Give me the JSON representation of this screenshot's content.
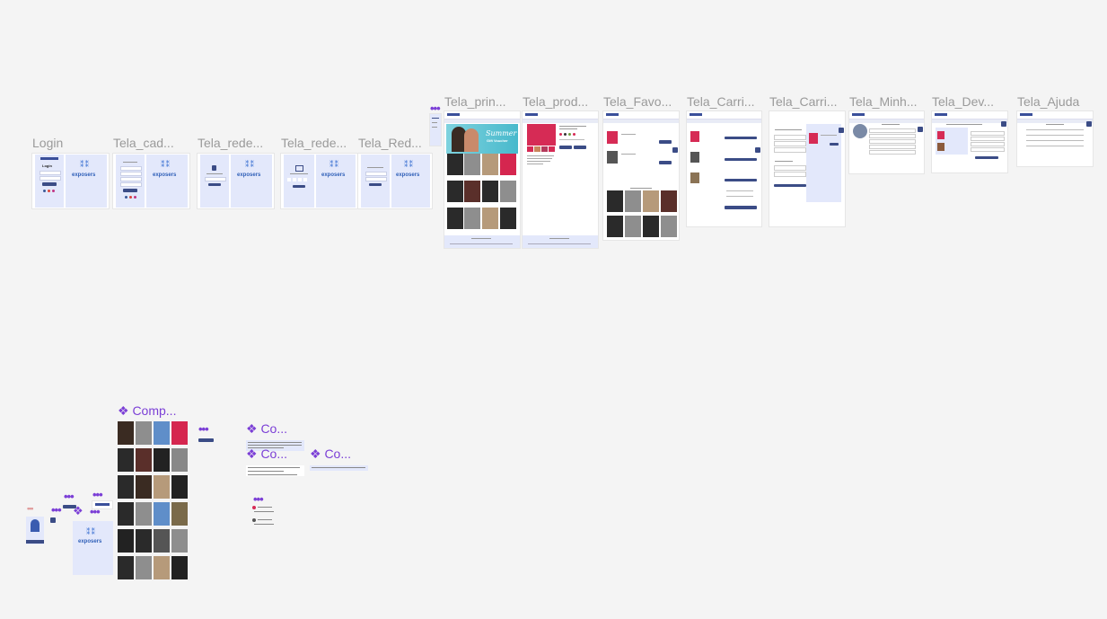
{
  "canvas": {
    "background": "#f4f4f4"
  },
  "frames": {
    "login": "Login",
    "cadastro": "Tela_cad...",
    "rede1": "Tela_rede...",
    "rede2": "Tela_rede...",
    "red3": "Tela_Red...",
    "principal": "Tela_prin...",
    "produto": "Tela_prod...",
    "favoritos": "Tela_Favo...",
    "carrinho1": "Tela_Carri...",
    "carrinho2": "Tela_Carri...",
    "minha": "Tela_Minh...",
    "devolucao": "Tela_Dev...",
    "ajuda": "Tela_Ajuda"
  },
  "components": {
    "comp1": "❖ Comp...",
    "comp2": "❖ Co...",
    "comp3": "❖ Co...",
    "comp4": "❖ Co..."
  },
  "brand": {
    "logo_text": "exposers",
    "logo_mark": "⁑⁑",
    "accent": "#3b4c86",
    "panel": "#e3e8fb",
    "purple": "#7b3fd6"
  },
  "login": {
    "title": "Login"
  },
  "banner": {
    "line1": "Summer",
    "line2": "Gift Voucher"
  },
  "dots": "•••"
}
